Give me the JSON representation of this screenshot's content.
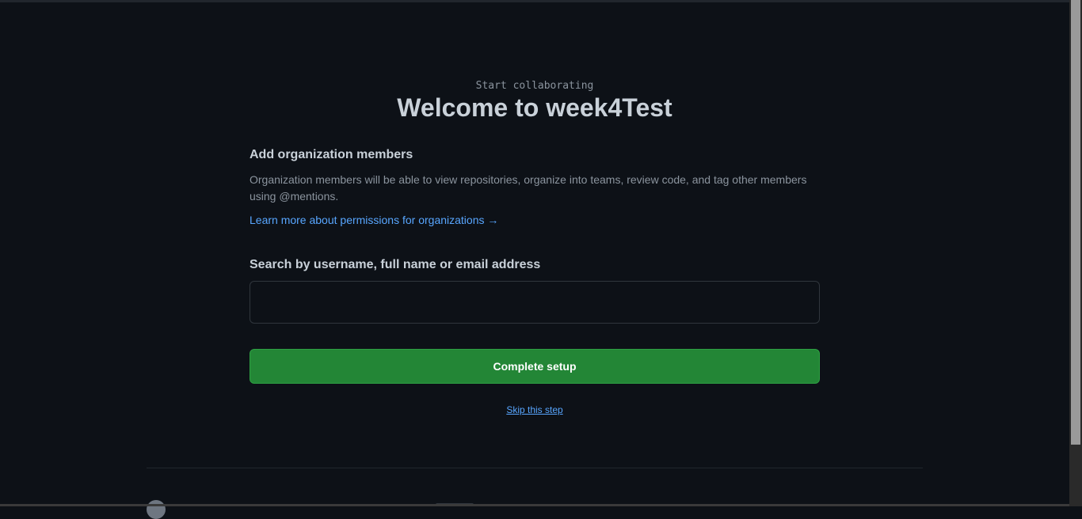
{
  "header": {
    "subtitle": "Start collaborating",
    "title": "Welcome to week4Test"
  },
  "members": {
    "heading": "Add organization members",
    "description": "Organization members will be able to view repositories, organize into teams, review code, and tag other members using @mentions.",
    "learn_link": "Learn more about permissions for organizations →"
  },
  "search": {
    "label": "Search by username, full name or email address",
    "value": "",
    "placeholder": ""
  },
  "actions": {
    "complete_label": "Complete setup",
    "skip_label": "Skip this step"
  },
  "colors": {
    "background": "#0d1117",
    "accent_green": "#238636",
    "link_blue": "#58a6ff"
  }
}
